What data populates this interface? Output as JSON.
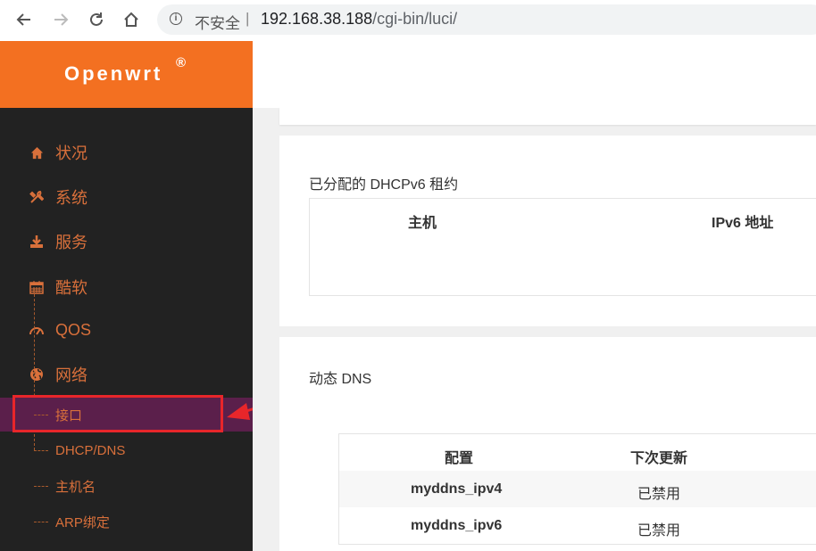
{
  "browser": {
    "insecure_label": "不安全",
    "separator": "|",
    "url_host": "192.168.38.188",
    "url_path": "/cgi-bin/luci/"
  },
  "header": {
    "logo": "Openwrt",
    "logo_mark": "®"
  },
  "sidebar": {
    "items": [
      {
        "label": "状况",
        "icon": "home-icon"
      },
      {
        "label": "系统",
        "icon": "tools-icon"
      },
      {
        "label": "服务",
        "icon": "download-icon"
      },
      {
        "label": "酷软",
        "icon": "calendar-icon"
      },
      {
        "label": "QOS",
        "icon": "gauge-icon"
      },
      {
        "label": "网络",
        "icon": "globe-icon"
      }
    ],
    "sub_items": [
      {
        "label": "接口",
        "active": true
      },
      {
        "label": "DHCP/DNS"
      },
      {
        "label": "主机名"
      },
      {
        "label": "ARP绑定"
      }
    ]
  },
  "dhcpv6": {
    "title": "已分配的 DHCPv6 租约",
    "columns": [
      "主机",
      "IPv6 地址"
    ]
  },
  "ddns": {
    "title": "动态 DNS",
    "columns": [
      "配置",
      "下次更新"
    ],
    "rows": [
      {
        "config": "myddns_ipv4",
        "next": "已禁用"
      },
      {
        "config": "myddns_ipv6",
        "next": "已禁用"
      }
    ]
  },
  "colors": {
    "accent": "#f37021",
    "sidebar_bg": "#222222",
    "active_bg": "#5b1f4b",
    "highlight": "#e8262a"
  }
}
